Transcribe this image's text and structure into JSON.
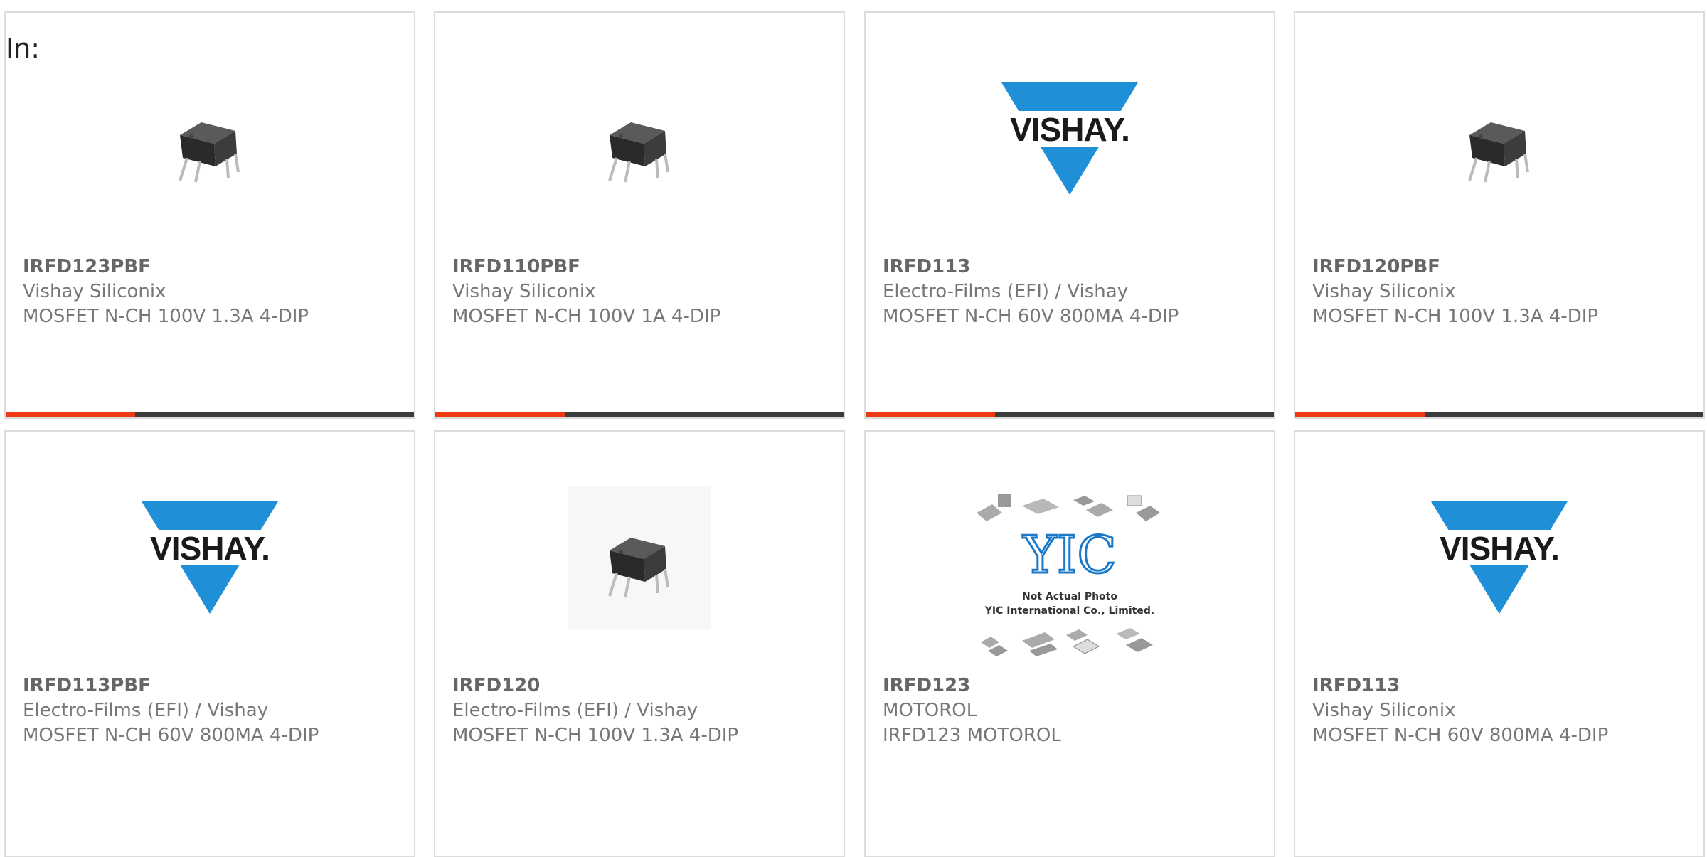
{
  "filter": {
    "label": "In:"
  },
  "colors": {
    "accent": "#ee3a13",
    "bar": "#3b3b3b",
    "vishay_blue": "#1f8fd8",
    "border": "#dcdcdc"
  },
  "cards": [
    {
      "part": "IRFD123PBF",
      "manufacturer": "Vishay Siliconix",
      "description": "MOSFET N-CH 100V 1.3A 4-DIP",
      "image": "dip-chip-icon",
      "progress": 0.32
    },
    {
      "part": "IRFD110PBF",
      "manufacturer": "Vishay Siliconix",
      "description": "MOSFET N-CH 100V 1A 4-DIP",
      "image": "dip-chip-icon",
      "progress": 0.32
    },
    {
      "part": "IRFD113",
      "manufacturer": "Electro-Films (EFI) / Vishay",
      "description": "MOSFET N-CH 60V 800MA 4-DIP",
      "image": "vishay-logo",
      "logo_text": "VISHAY.",
      "progress": 0.32
    },
    {
      "part": "IRFD120PBF",
      "manufacturer": "Vishay Siliconix",
      "description": "MOSFET N-CH 100V 1.3A 4-DIP",
      "image": "dip-chip-icon",
      "progress": 0.32
    },
    {
      "part": "IRFD113PBF",
      "manufacturer": "Electro-Films (EFI) / Vishay",
      "description": "MOSFET N-CH 60V 800MA 4-DIP",
      "image": "vishay-logo",
      "logo_text": "VISHAY."
    },
    {
      "part": "IRFD120",
      "manufacturer": "Electro-Films (EFI) / Vishay",
      "description": "MOSFET N-CH 100V 1.3A 4-DIP",
      "image": "dip-chip-icon"
    },
    {
      "part": "IRFD123",
      "manufacturer": "MOTOROL",
      "description": "IRFD123 MOTOROL",
      "image": "yic-placeholder",
      "logo_text": "YIC",
      "caption_1": "Not Actual Photo",
      "caption_2": "YIC International Co., Limited."
    },
    {
      "part": "IRFD113",
      "manufacturer": "Vishay Siliconix",
      "description": "MOSFET N-CH 60V 800MA 4-DIP",
      "image": "vishay-logo",
      "logo_text": "VISHAY."
    }
  ]
}
